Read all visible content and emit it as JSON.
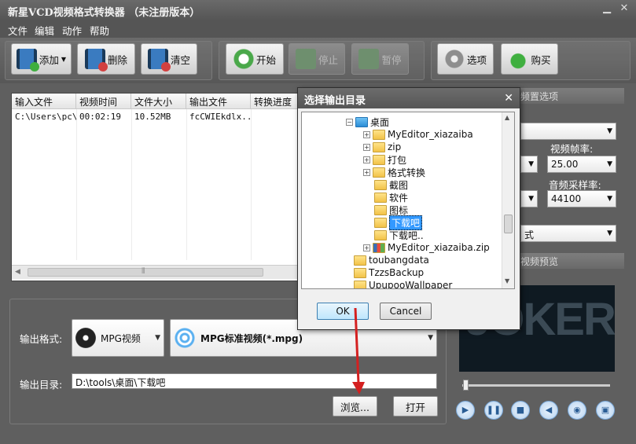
{
  "window": {
    "title": "新星VCD视频格式转换器 （未注册版本）",
    "minimize": "▁",
    "close": "✕"
  },
  "menu": [
    "文件",
    "编辑",
    "动作",
    "帮助"
  ],
  "toolbar": {
    "add": "添加",
    "delete": "删除",
    "clear": "清空",
    "start": "开始",
    "stop": "停止",
    "pause": "暂停",
    "options": "选项",
    "buy": "购买"
  },
  "table": {
    "headers": [
      "输入文件",
      "视频时间",
      "文件大小",
      "输出文件",
      "转换进度"
    ],
    "rows": [
      [
        "C:\\Users\\pc\\...",
        "00:02:19",
        "10.52MB",
        "fcCWIEkdlx..."
      ]
    ],
    "scroll_grip": "⦀"
  },
  "output": {
    "format_label": "输出格式:",
    "format_category": "MPG视频",
    "format_detail": "MPG标准视频(*.mpg)",
    "dir_label": "输出目录:",
    "dir_value": "D:\\tools\\桌面\\下载吧",
    "browse": "浏览...",
    "open": "打开"
  },
  "right_panel": {
    "settings_title": "频置选项",
    "fps_label": "视频帧率:",
    "fps_value": "25.00",
    "sample_label": "音频采样率:",
    "sample_value": "44100",
    "partial_label": "式",
    "preview_title": "视频预览",
    "preview_text": "JOKER"
  },
  "dialog": {
    "title": "选择输出目录",
    "close": "✕",
    "tree": [
      {
        "label": "桌面",
        "indent": 0,
        "expander": "−",
        "type": "blue"
      },
      {
        "label": "MyEditor_xiazaiba",
        "indent": 1,
        "expander": "+",
        "type": "folder"
      },
      {
        "label": "zip",
        "indent": 1,
        "expander": "+",
        "type": "folder"
      },
      {
        "label": "打包",
        "indent": 1,
        "expander": "+",
        "type": "folder"
      },
      {
        "label": "格式转换",
        "indent": 1,
        "expander": "+",
        "type": "folder"
      },
      {
        "label": "截图",
        "indent": 1,
        "expander": "",
        "type": "folder"
      },
      {
        "label": "软件",
        "indent": 1,
        "expander": "",
        "type": "folder"
      },
      {
        "label": "图标",
        "indent": 1,
        "expander": "",
        "type": "folder"
      },
      {
        "label": "下载吧",
        "indent": 1,
        "expander": "",
        "type": "folder",
        "selected": true
      },
      {
        "label": "下载吧..",
        "indent": 1,
        "expander": "",
        "type": "folder"
      },
      {
        "label": "MyEditor_xiazaiba.zip",
        "indent": 1,
        "expander": "+",
        "type": "zip"
      },
      {
        "label": "toubangdata",
        "indent": -1,
        "expander": "",
        "type": "folder"
      },
      {
        "label": "TzzsBackup",
        "indent": -1,
        "expander": "",
        "type": "folder"
      },
      {
        "label": "UpupooWallpaper",
        "indent": -1,
        "expander": "",
        "type": "folder"
      }
    ],
    "ok": "OK",
    "cancel": "Cancel"
  },
  "colors": {
    "arrow": "#d42020",
    "selection": "#3399ff"
  }
}
